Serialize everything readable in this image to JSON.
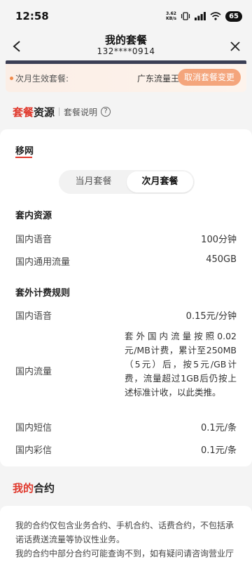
{
  "status": {
    "time": "12:58",
    "speed_top": "3.62",
    "speed_bottom": "KB/s",
    "battery": "65"
  },
  "nav": {
    "title": "我的套餐",
    "phone": "132****0914"
  },
  "next_month": {
    "label": "次月生效套餐:",
    "value": "广东流量王",
    "cancel_label": "取消套餐变更"
  },
  "resources_section": {
    "title_accent": "套餐",
    "title_rest": "资源",
    "link": "套餐说明",
    "help_glyph": "?"
  },
  "operator": {
    "name": "移网"
  },
  "tabs": [
    {
      "label": "当月套餐"
    },
    {
      "label": "次月套餐"
    }
  ],
  "active_tab": 1,
  "in_package": {
    "title": "套内资源",
    "rows": [
      {
        "label": "国内语音",
        "value": "100分钟"
      },
      {
        "label": "国内通用流量",
        "value": "450GB"
      }
    ]
  },
  "extra_rules": {
    "title": "套外计费规则",
    "voice": {
      "label": "国内语音",
      "value": "0.15元/分钟"
    },
    "data": {
      "label": "国内流量",
      "value": "套外国内流量按照0.02元/MB计费，累计至250MB（5元）后，按5元/GB计费，流量超过1GB后仍按上述标准计收，以此类推。"
    },
    "sms": {
      "label": "国内短信",
      "value": "0.1元/条"
    },
    "mms": {
      "label": "国内彩信",
      "value": "0.1元/条"
    }
  },
  "contract_section": {
    "title_accent": "我的",
    "title_rest": "合约",
    "text": "我的合约仅包含业务合约、手机合约、话费合约，不包括承诺话费送流量等协议性业务。",
    "text_cut": "我的合约中部分合约可能查询不到，如有疑问请咨询营业厅"
  },
  "colors": {
    "accent": "#e0382c",
    "cancel_button": "#f4a57c",
    "nav_stripe": "#3b3f55"
  }
}
